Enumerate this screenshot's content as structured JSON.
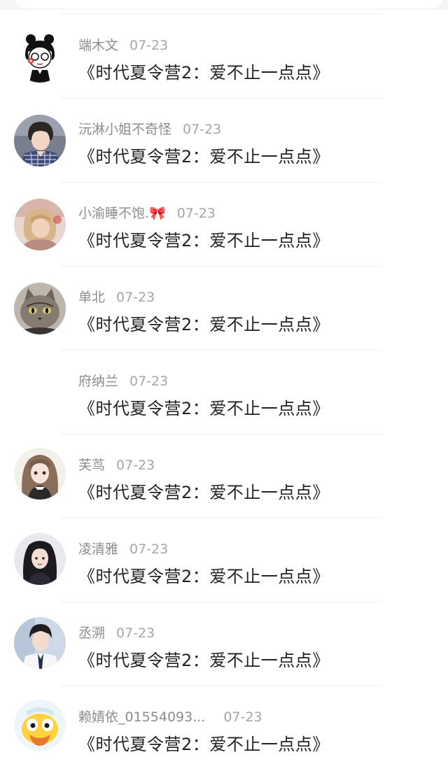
{
  "comments": [
    {
      "name": "端木文",
      "time": "07-23",
      "text": "《时代夏令营2：爱不止一点点》",
      "avatar": "cartoon-girl-avatar"
    },
    {
      "name": "沅淋小姐不奇怪",
      "time": "07-23",
      "text": "《时代夏令营2：爱不止一点点》",
      "avatar": "boy-plaid-shirt-avatar"
    },
    {
      "name": "小渝睡不饱.🎀",
      "time": "07-23",
      "text": "《时代夏令营2：爱不止一点点》",
      "avatar": "blonde-child-avatar"
    },
    {
      "name": "单北",
      "time": "07-23",
      "text": "《时代夏令营2：爱不止一点点》",
      "avatar": "cat-avatar"
    },
    {
      "name": "府纳兰",
      "time": "07-23",
      "text": "《时代夏令营2：爱不止一点点》",
      "avatar": ""
    },
    {
      "name": "芙茑",
      "time": "07-23",
      "text": "《时代夏令营2：爱不止一点点》",
      "avatar": "anime-girl-avatar"
    },
    {
      "name": "凌清雅",
      "time": "07-23",
      "text": "《时代夏令营2：爱不止一点点》",
      "avatar": "dark-hair-girl-avatar"
    },
    {
      "name": "丞溯",
      "time": "07-23",
      "text": "《时代夏令营2：爱不止一点点》",
      "avatar": "boy-white-shirt-avatar"
    },
    {
      "name": "赖婧依_01554093...",
      "time": "07-23",
      "text": "《时代夏令营2：爱不止一点点》",
      "avatar": "yellow-cartoon-avatar"
    }
  ]
}
